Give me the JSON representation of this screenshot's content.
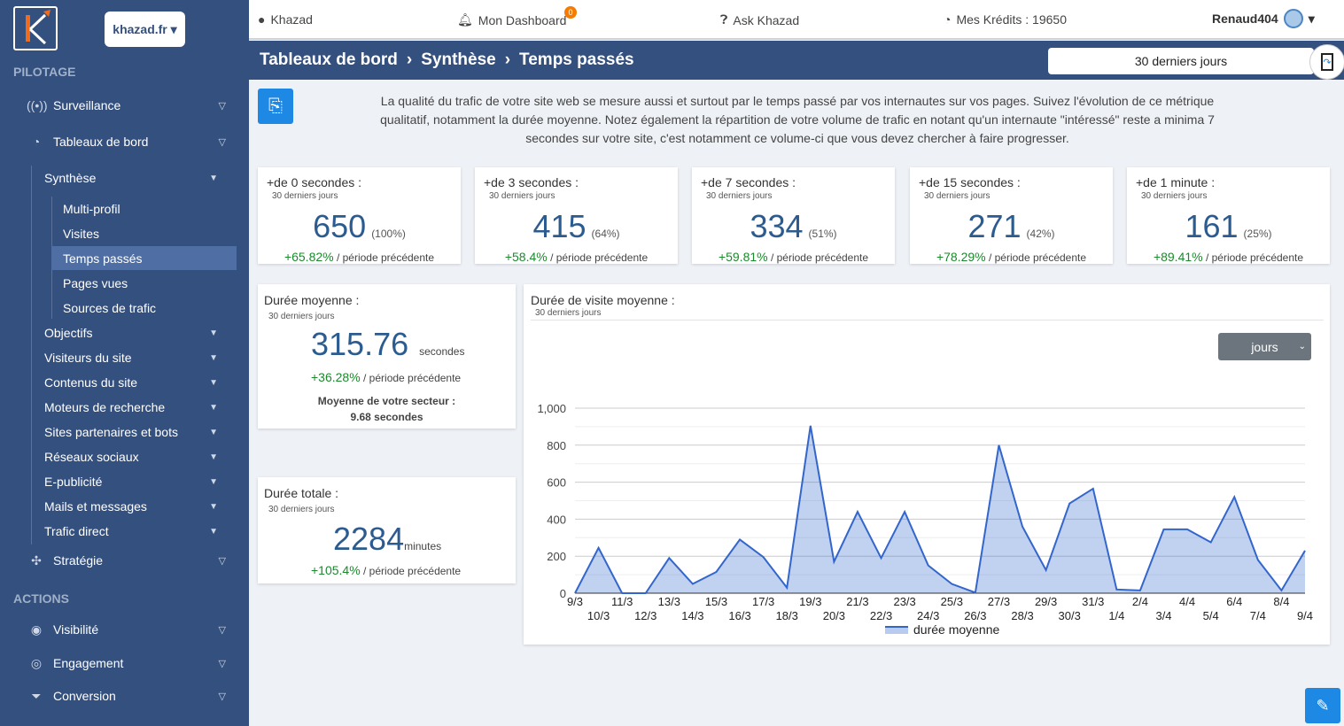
{
  "sidebar": {
    "site_selector": "khazad.fr",
    "section_pilotage": "PILOTAGE",
    "section_actions": "ACTIONS",
    "items": [
      {
        "label": "Surveillance",
        "icon": "broadcast-icon"
      },
      {
        "label": "Tableaux de bord",
        "icon": "dashboard-gauge-icon"
      },
      {
        "label": "Stratégie",
        "icon": "puzzle-icon"
      },
      {
        "label": "Visibilité",
        "icon": "eye-icon"
      },
      {
        "label": "Engagement",
        "icon": "target-icon"
      },
      {
        "label": "Conversion",
        "icon": "funnel-icon"
      }
    ],
    "dashboard_sub": [
      "Synthèse",
      "Objectifs",
      "Visiteurs du site",
      "Contenus du site",
      "Moteurs de recherche",
      "Sites partenaires et bots",
      "Réseaux sociaux",
      "E-publicité",
      "Mails et messages",
      "Trafic direct"
    ],
    "synthese_sub": [
      "Multi-profil",
      "Visites",
      "Temps passés",
      "Pages vues",
      "Sources de trafic"
    ],
    "active": "Temps passés"
  },
  "topbar": {
    "brand": "Khazad",
    "dashboard": "Mon Dashboard",
    "notif_count": "0",
    "ask": "Ask Khazad",
    "credits": "Mes Krédits : 19650",
    "user": "Renaud404"
  },
  "breadcrumb": [
    "Tableaux de bord",
    "Synthèse",
    "Temps passés"
  ],
  "period": "30 derniers jours",
  "intro": "La qualité du trafic de votre site web se mesure aussi et surtout par le temps passé par vos internautes sur vos pages. Suivez l'évolution de ce métrique qualitatif, notamment la durée moyenne. Notez également la répartition de votre volume de trafic en notant qu'un internaute \"intéressé\" reste a minima 7 secondes sur votre site, c'est notamment ce volume-ci que vous devez chercher à faire progresser.",
  "kpis": [
    {
      "title": "+de 0 secondes :",
      "sub": "30 derniers jours",
      "value": "650",
      "pct": "(100%)",
      "evo": "+65.82%",
      "evo_label": "/ période précédente"
    },
    {
      "title": "+de 3 secondes :",
      "sub": "30 derniers jours",
      "value": "415",
      "pct": "(64%)",
      "evo": "+58.4%",
      "evo_label": "/ période précédente"
    },
    {
      "title": "+de 7 secondes :",
      "sub": "30 derniers jours",
      "value": "334",
      "pct": "(51%)",
      "evo": "+59.81%",
      "evo_label": "/ période précédente"
    },
    {
      "title": "+de 15 secondes :",
      "sub": "30 derniers jours",
      "value": "271",
      "pct": "(42%)",
      "evo": "+78.29%",
      "evo_label": "/ période précédente"
    },
    {
      "title": "+de 1 minute :",
      "sub": "30 derniers jours",
      "value": "161",
      "pct": "(25%)",
      "evo": "+89.41%",
      "evo_label": "/ période précédente"
    }
  ],
  "avg": {
    "title": "Durée moyenne :",
    "sub": "30 derniers jours",
    "value": "315.76",
    "unit": "secondes",
    "evo": "+36.28%",
    "evo_label": "/ période précédente",
    "sector_label": "Moyenne de votre secteur :",
    "sector_value": "9.68 secondes"
  },
  "total": {
    "title": "Durée totale :",
    "sub": "30 derniers jours",
    "value": "2284",
    "unit": "minutes",
    "evo": "+105.4%",
    "evo_label": "/ période précédente"
  },
  "chart_card": {
    "title": "Durée de visite moyenne :",
    "sub": "30 derniers jours",
    "granularity": "jours"
  },
  "chart_data": {
    "type": "area",
    "categories": [
      "9/3",
      "10/3",
      "11/3",
      "12/3",
      "13/3",
      "14/3",
      "15/3",
      "16/3",
      "17/3",
      "18/3",
      "19/3",
      "20/3",
      "21/3",
      "22/3",
      "23/3",
      "24/3",
      "25/3",
      "26/3",
      "27/3",
      "28/3",
      "29/3",
      "30/3",
      "31/3",
      "1/4",
      "2/4",
      "3/4",
      "4/4",
      "5/4",
      "6/4",
      "7/4",
      "8/4",
      "9/4"
    ],
    "series": [
      {
        "name": "durée moyenne",
        "values": [
          0,
          245,
          0,
          0,
          190,
          50,
          115,
          290,
          195,
          30,
          905,
          170,
          440,
          190,
          440,
          150,
          50,
          3,
          800,
          360,
          125,
          485,
          565,
          20,
          15,
          345,
          345,
          275,
          520,
          180,
          15,
          230
        ]
      }
    ],
    "ylim": [
      0,
      1000
    ],
    "yticks": [
      0,
      200,
      400,
      600,
      800,
      1000
    ],
    "ytick_labels": [
      "0",
      "200",
      "400",
      "600",
      "800",
      "1,000"
    ],
    "grid": true,
    "legend": "bottom",
    "color": "#3366cc"
  }
}
